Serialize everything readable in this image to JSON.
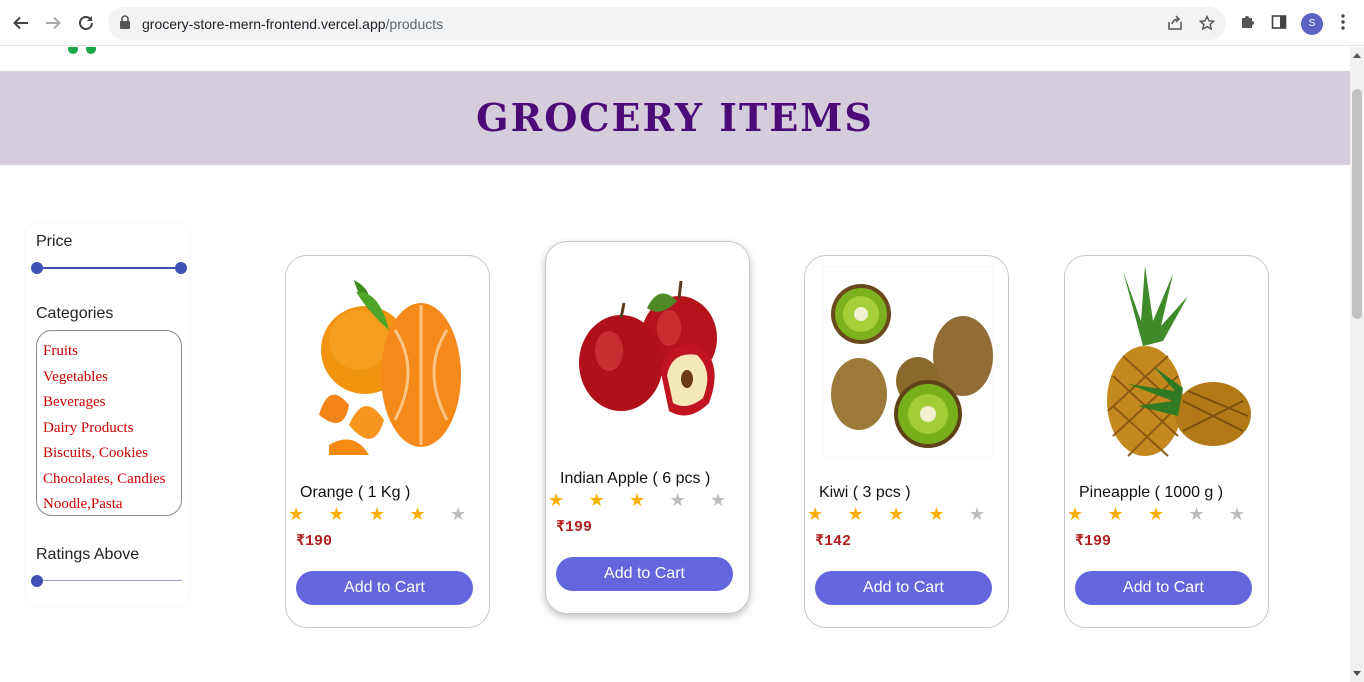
{
  "browser": {
    "url_domain": "grocery-store-mern-frontend.vercel.app",
    "url_path": "/products",
    "profile_initial": "S"
  },
  "banner": {
    "title": "GROCERY ITEMS"
  },
  "filters": {
    "price_label": "Price",
    "categories_label": "Categories",
    "categories": [
      "Fruits",
      "Vegetables",
      "Beverages",
      "Dairy Products",
      "Biscuits, Cookies",
      "Chocolates, Candies",
      "Noodle,Pasta"
    ],
    "ratings_label": "Ratings Above",
    "ratings_value": 0
  },
  "products": [
    {
      "name": "Orange ( 1 Kg )",
      "rating": 4,
      "price": "₹190",
      "button": "Add to Cart",
      "image": "orange-image"
    },
    {
      "name": "Indian Apple ( 6 pcs )",
      "rating": 3,
      "price": "₹199",
      "button": "Add to Cart",
      "image": "apple-image"
    },
    {
      "name": "Kiwi ( 3 pcs )",
      "rating": 4,
      "price": "₹142",
      "button": "Add to Cart",
      "image": "kiwi-image"
    },
    {
      "name": "Pineapple ( 1000 g )",
      "rating": 3,
      "price": "₹199",
      "button": "Add to Cart",
      "image": "pineapple-image"
    }
  ],
  "colors": {
    "banner_bg": "#d5ccdc",
    "title": "#4b0a78",
    "button": "#6366dc",
    "price": "#b01e1e",
    "star": "#faaf00",
    "category": "#cc0000"
  }
}
